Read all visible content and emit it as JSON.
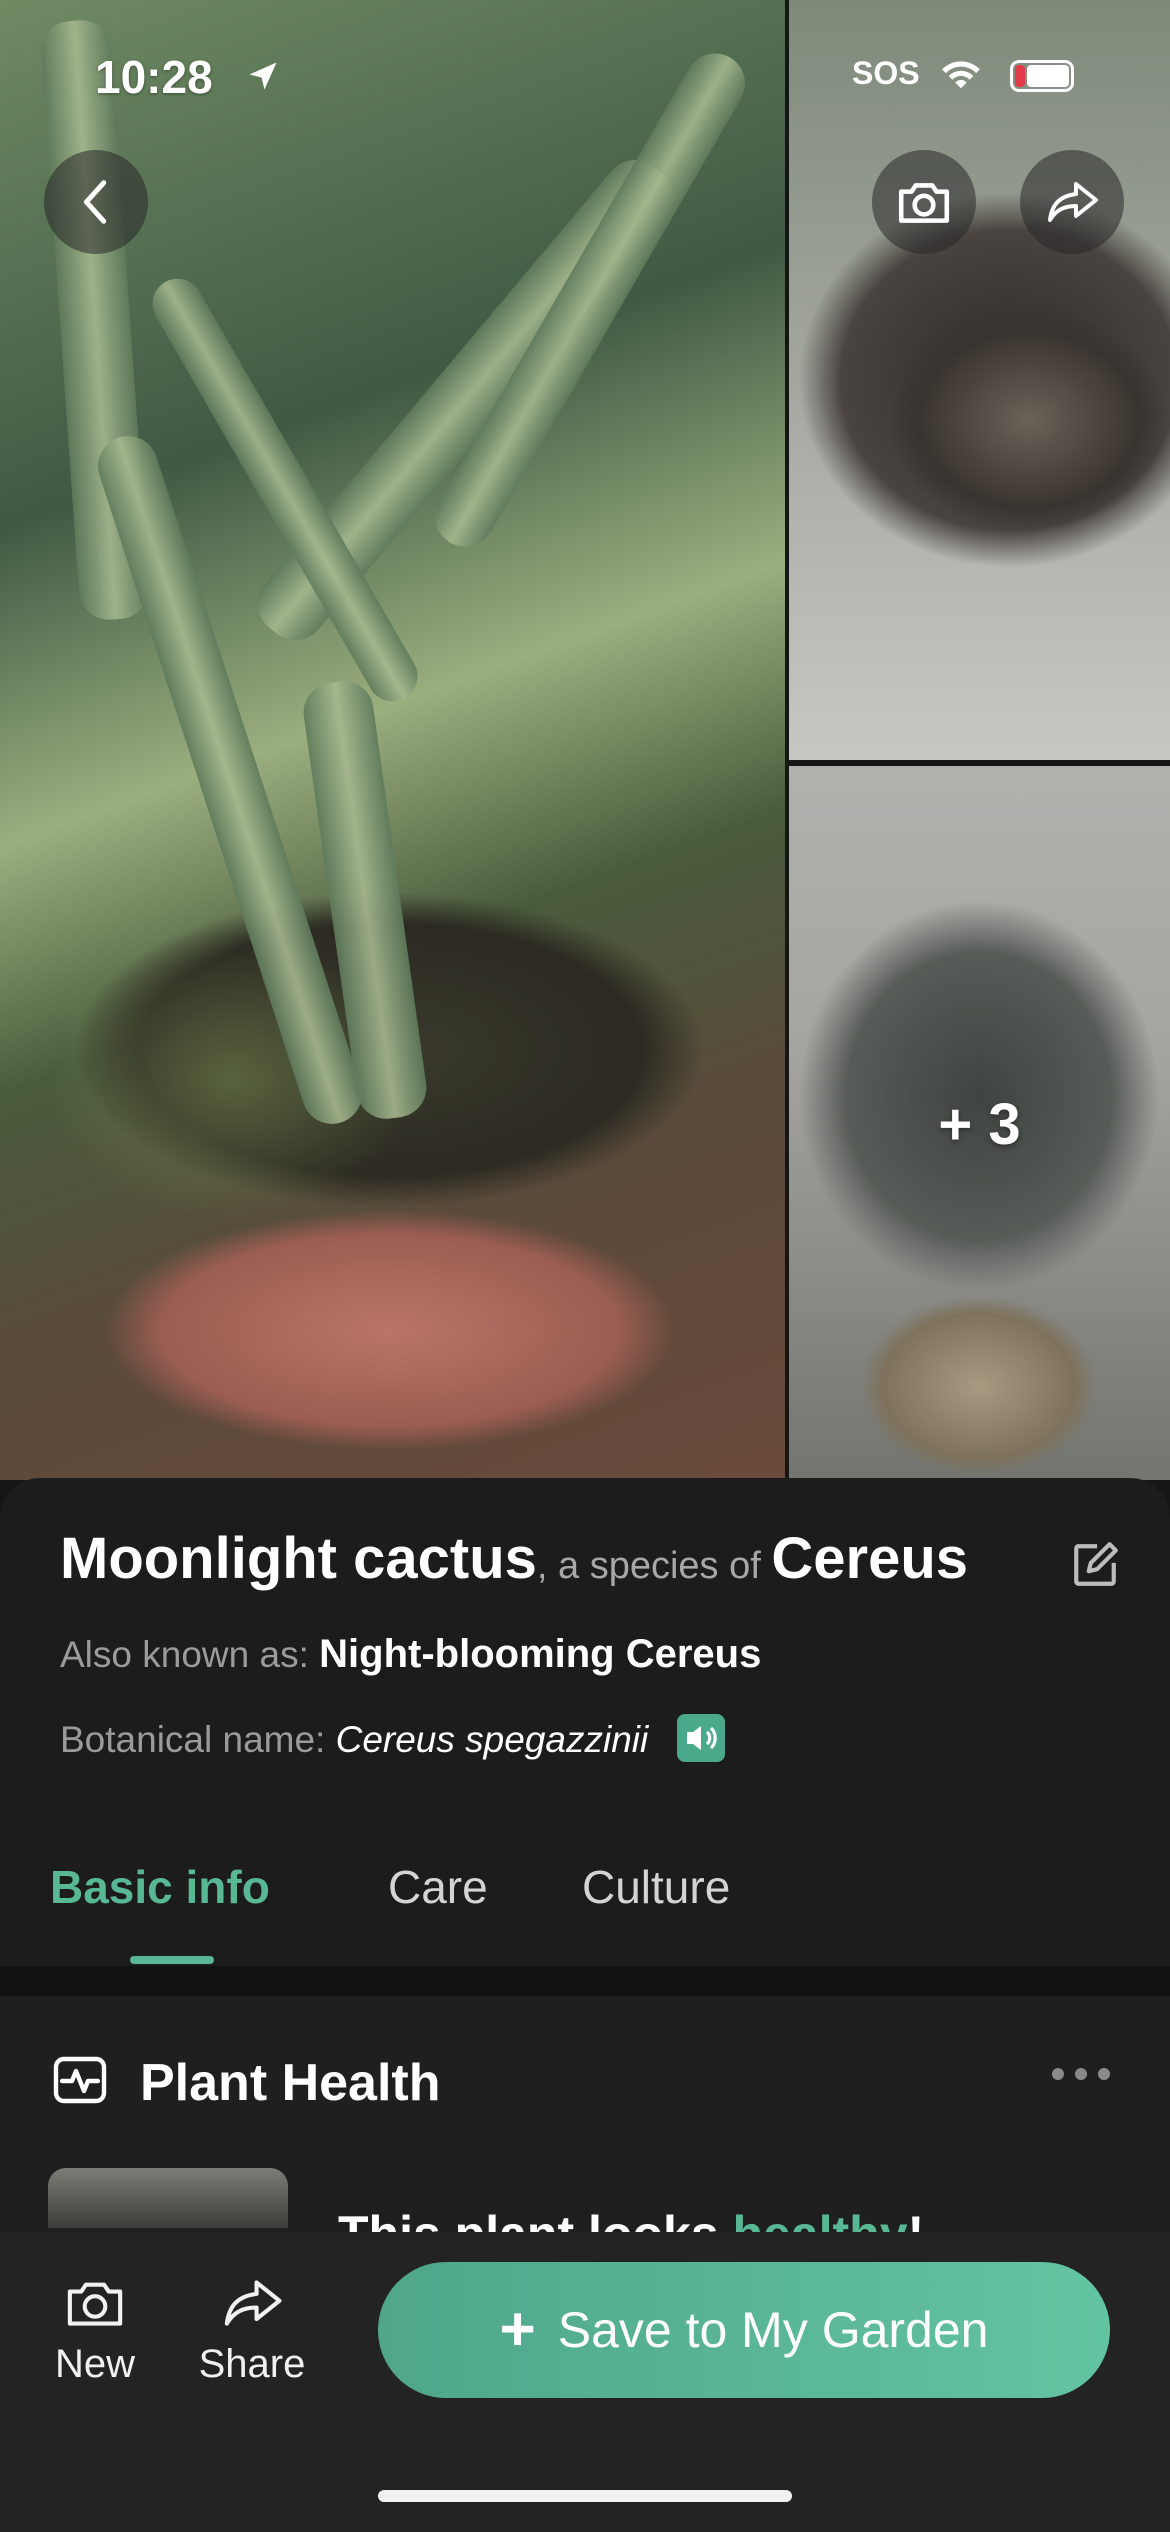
{
  "status_bar": {
    "time": "10:28",
    "carrier": "SOS",
    "location_icon": "location-arrow-icon",
    "wifi_icon": "wifi-icon",
    "battery_icon": "battery-icon"
  },
  "gallery": {
    "more_photos_label": "+ 3",
    "back_icon": "chevron-left-icon",
    "camera_icon": "camera-icon",
    "share_icon": "share-arrow-icon"
  },
  "plant": {
    "common_name": "Moonlight cactus",
    "connector": ", a species of ",
    "genus": "Cereus",
    "also_known_label": "Also known as: ",
    "also_known_value": "Night-blooming Cereus",
    "botanical_label": "Botanical name: ",
    "botanical_value": "Cereus spegazzinii"
  },
  "tabs": [
    {
      "label": "Basic info",
      "active": true
    },
    {
      "label": "Care",
      "active": false
    },
    {
      "label": "Culture",
      "active": false
    }
  ],
  "health": {
    "title": "Plant Health",
    "status_prefix": "This plant looks ",
    "status_word": "healthy",
    "status_suffix": "!"
  },
  "bottom_bar": {
    "new_label": "New",
    "share_label": "Share",
    "save_label": "Save to My Garden"
  },
  "colors": {
    "accent": "#58b894",
    "sheet_bg": "#1c1c1c",
    "bar_bg": "#232323"
  }
}
